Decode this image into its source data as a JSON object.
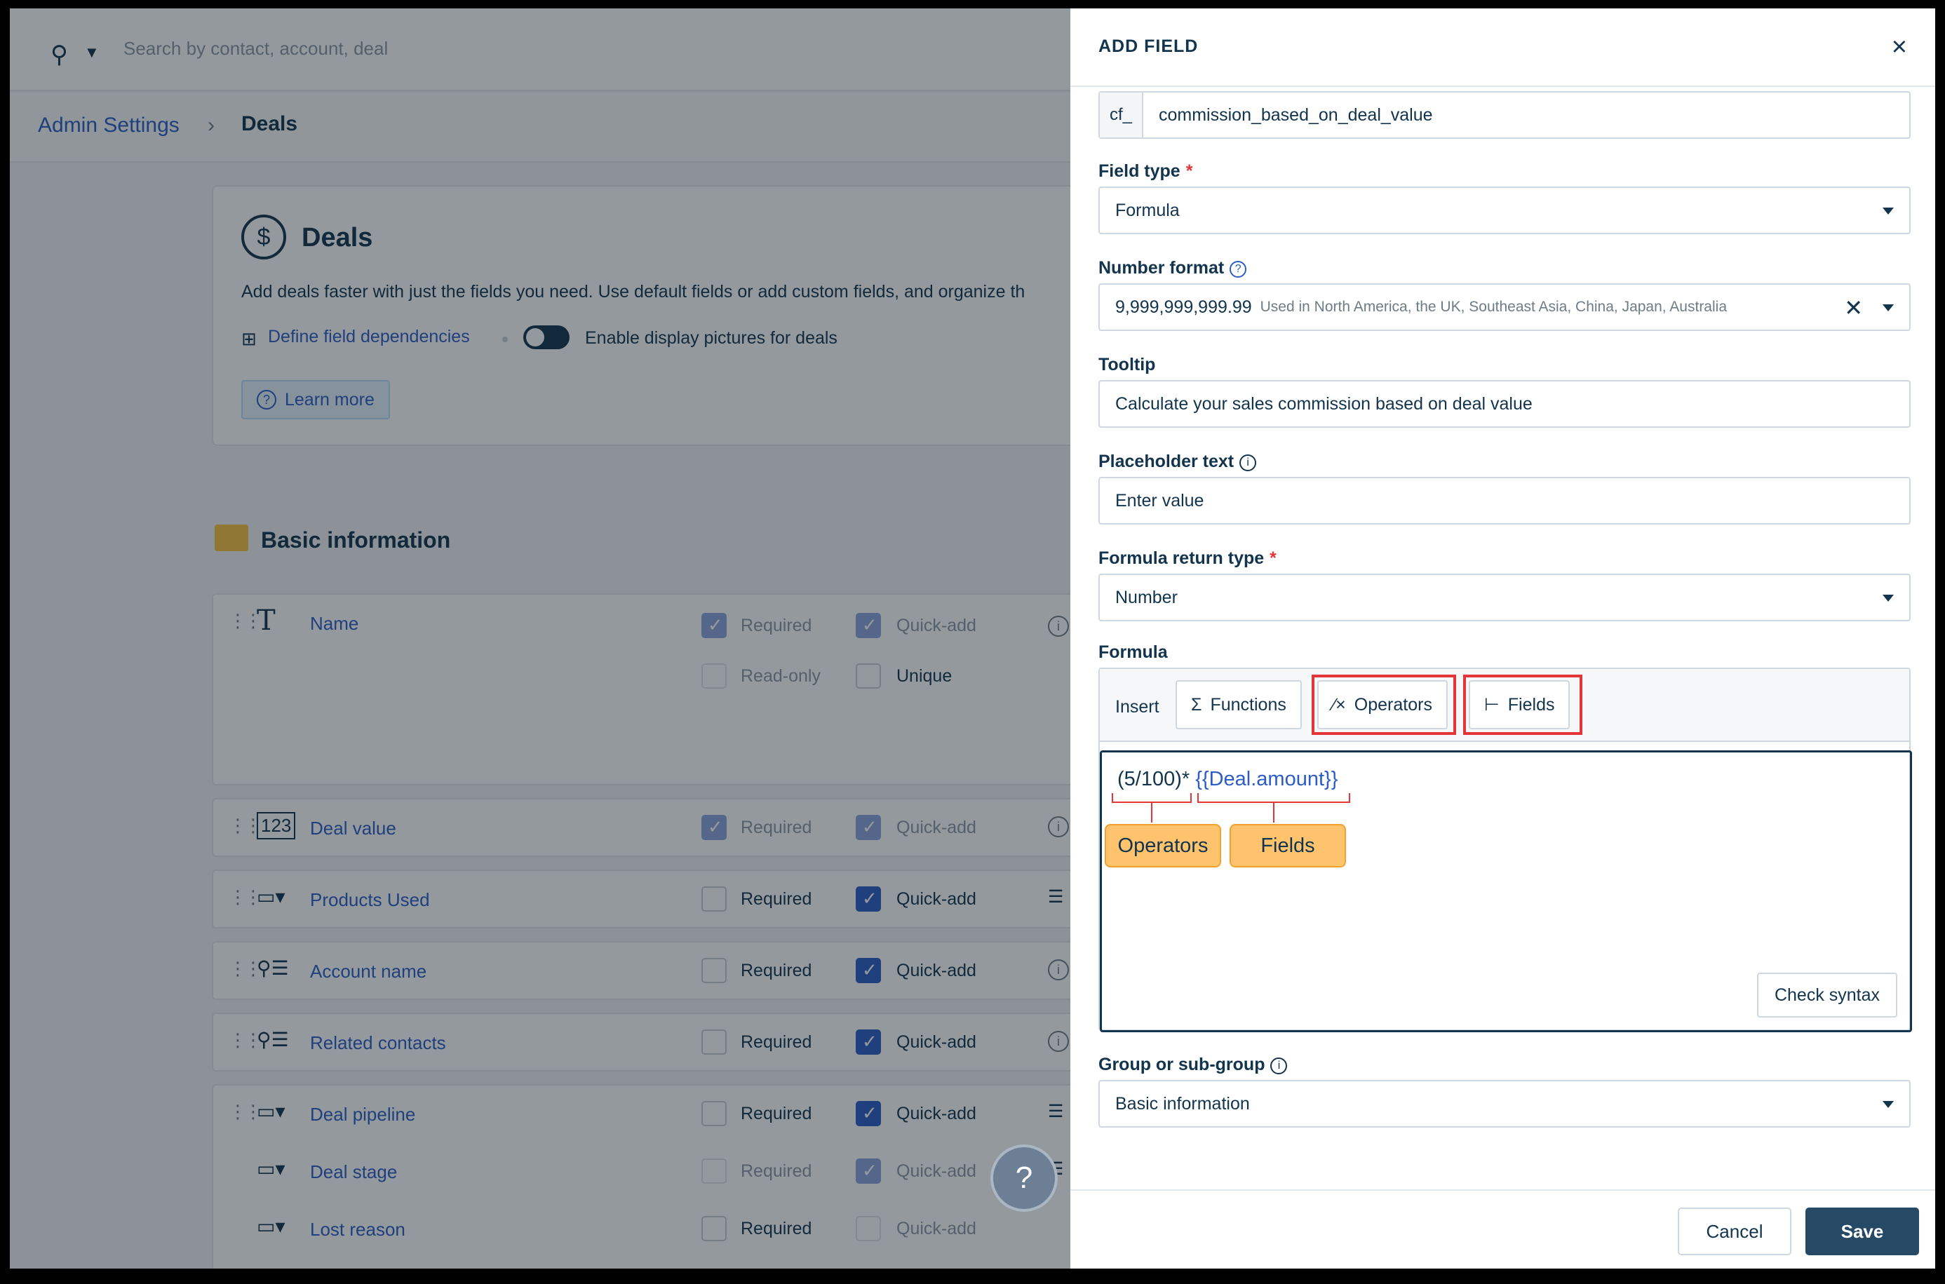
{
  "background": {
    "search": {
      "placeholder": "Search by contact, account, deal"
    },
    "breadcrumb": {
      "parent": "Admin Settings",
      "current": "Deals"
    },
    "deals_card": {
      "title": "Deals",
      "description": "Add deals faster with just the fields you need. Use default fields or add custom fields, and organize th",
      "dependencies_link": "Define field dependencies",
      "display_pictures_label": "Enable display pictures for deals",
      "learn_more": "Learn more"
    },
    "section_title": "Basic information",
    "labels": {
      "required": "Required",
      "quick_add": "Quick-add",
      "read_only": "Read-only",
      "unique": "Unique"
    },
    "fields": [
      {
        "name": "Name",
        "type_icon": "text-icon",
        "required": true,
        "quick_add": true,
        "disabled": true
      },
      {
        "name": "Deal value",
        "type_icon": "number-icon",
        "required": true,
        "quick_add": true,
        "disabled": true
      },
      {
        "name": "Products Used",
        "type_icon": "dropdown-icon",
        "required": false,
        "quick_add": true,
        "disabled": false
      },
      {
        "name": "Account name",
        "type_icon": "lookup-icon",
        "required": false,
        "quick_add": true,
        "disabled": false
      },
      {
        "name": "Related contacts",
        "type_icon": "lookup-icon",
        "required": false,
        "quick_add": true,
        "disabled": false
      },
      {
        "name": "Deal pipeline",
        "type_icon": "dropdown-icon",
        "required": false,
        "quick_add": true,
        "disabled": false
      },
      {
        "name": "Deal stage",
        "type_icon": "dropdown-icon",
        "required": false,
        "quick_add": true,
        "disabled": true
      },
      {
        "name": "Lost reason",
        "type_icon": "dropdown-icon",
        "required": false,
        "quick_add": false,
        "disabled": true
      }
    ],
    "help_label": "?"
  },
  "drawer": {
    "title": "ADD FIELD",
    "close_icon": "×",
    "internal_name": {
      "prefix": "cf_",
      "value": "commission_based_on_deal_value"
    },
    "field_type": {
      "label": "Field type",
      "value": "Formula"
    },
    "number_format": {
      "label": "Number format",
      "value": "9,999,999,999.99",
      "hint": "Used in North America, the UK, Southeast Asia, China, Japan, Australia"
    },
    "tooltip": {
      "label": "Tooltip",
      "value": "Calculate your sales commission based on deal value"
    },
    "placeholder_text": {
      "label": "Placeholder text",
      "value": "Enter value"
    },
    "formula_return_type": {
      "label": "Formula return type",
      "value": "Number"
    },
    "formula": {
      "label": "Formula",
      "insert_label": "Insert",
      "functions_btn": "Functions",
      "operators_btn": "Operators",
      "fields_btn": "Fields",
      "expression_operator": "(5/100)*",
      "expression_field": "{{Deal.amount}}",
      "callout_operators": "Operators",
      "callout_fields": "Fields",
      "check_syntax": "Check syntax"
    },
    "group": {
      "label": "Group or sub-group",
      "value": "Basic information"
    },
    "cancel": "Cancel",
    "save": "Save"
  }
}
